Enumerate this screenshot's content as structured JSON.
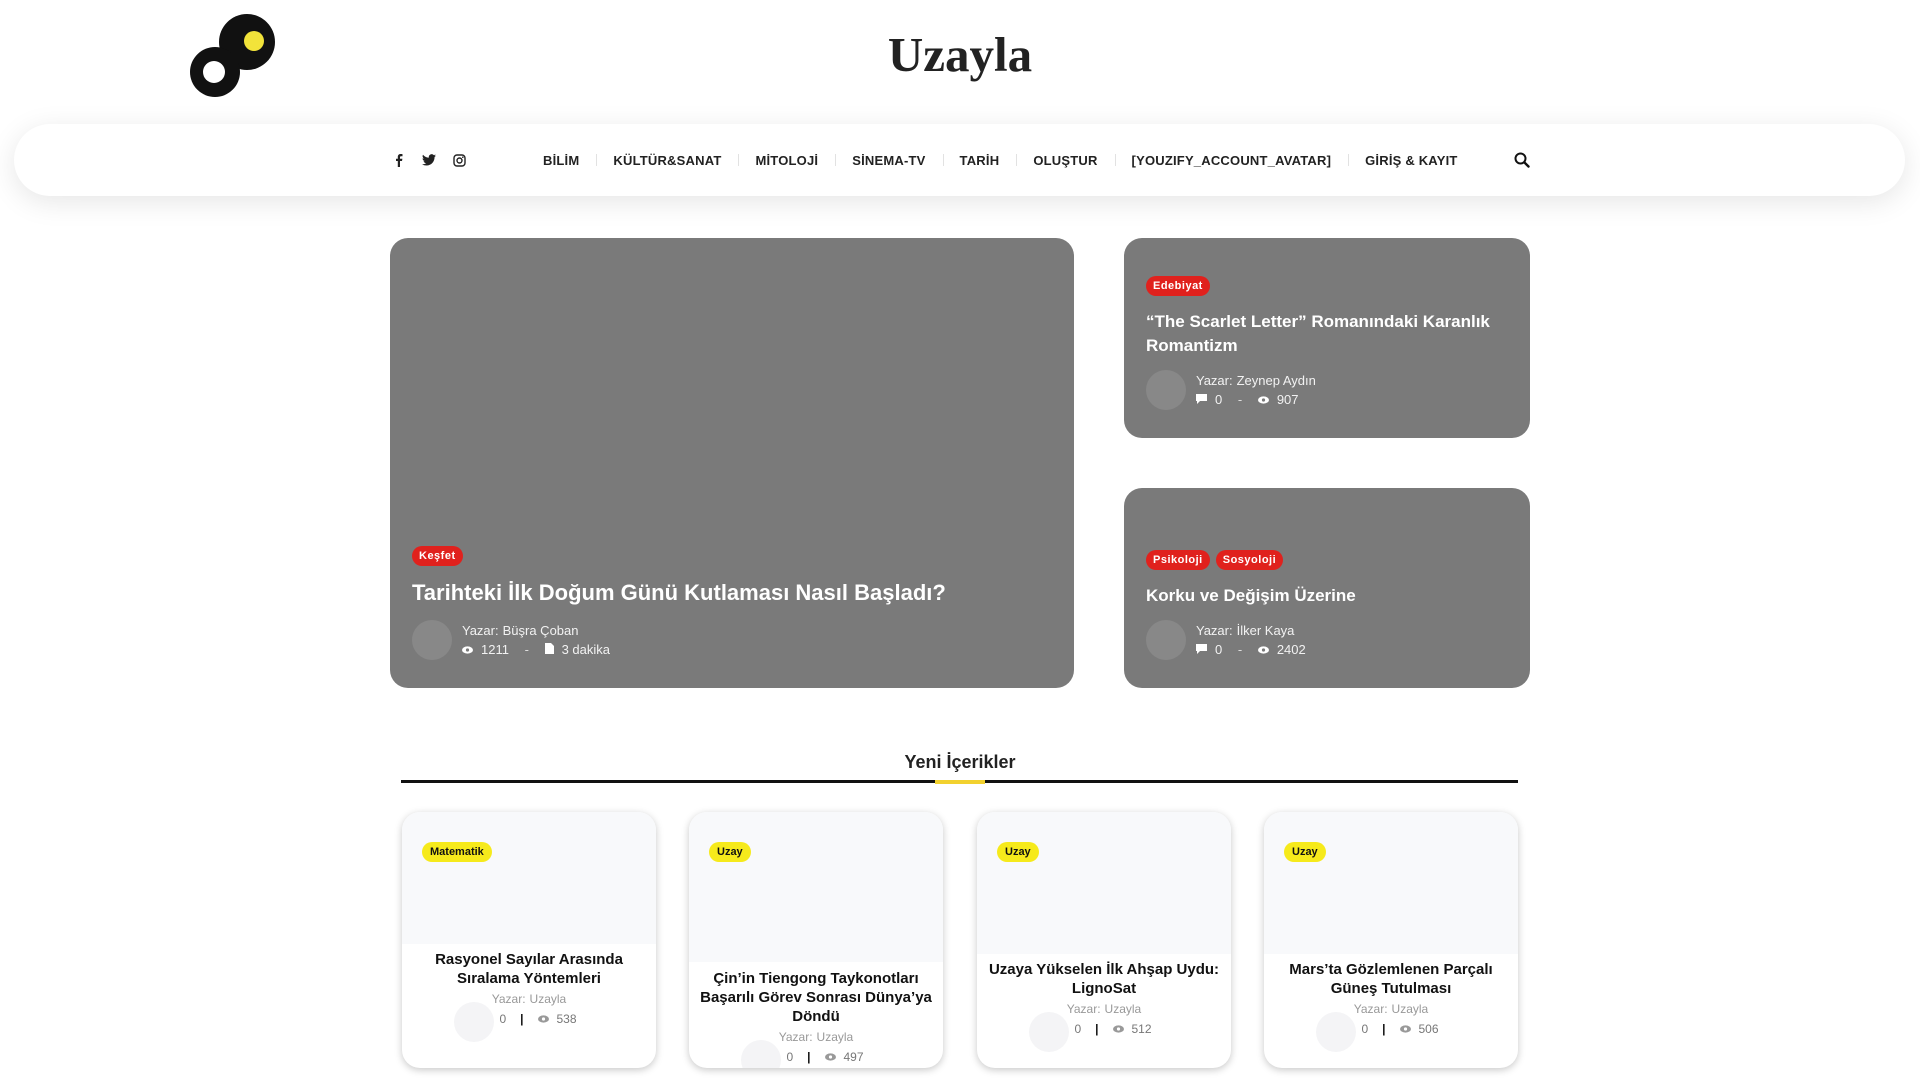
{
  "site": {
    "title": "Uzayla"
  },
  "nav": {
    "social": [
      "facebook-icon",
      "twitter-icon",
      "instagram-icon"
    ],
    "items": [
      "BİLİM",
      "KÜLTÜR&SANAT",
      "MİTOLOJİ",
      "SİNEMA-TV",
      "TARİH",
      "OLUŞTUR",
      "[YOUZIFY_ACCOUNT_AVATAR]",
      "GİRİŞ & KAYIT"
    ],
    "search_icon": "search-icon"
  },
  "featured": {
    "main": {
      "category": "Keşfet",
      "title": "Tarihteki İlk Doğum Günü Kutlaması Nasıl Başladı?",
      "author_label": "Yazar:",
      "author": "Büşra Çoban",
      "views": "1211",
      "read_time": "3 dakika"
    },
    "side": [
      {
        "categories": [
          "Edebiyat"
        ],
        "title": "“The Scarlet Letter” Romanındaki Karanlık Romantizm",
        "author_label": "Yazar:",
        "author": "Zeynep Aydın",
        "comments": "0",
        "views": "907"
      },
      {
        "categories": [
          "Psikoloji",
          "Sosyoloji"
        ],
        "title": "Korku ve Değişim Üzerine",
        "author_label": "Yazar:",
        "author": "İlker Kaya",
        "comments": "0",
        "views": "2402"
      }
    ]
  },
  "section": {
    "title": "Yeni İçerikler",
    "accent_color": "#f2d12e"
  },
  "posts": [
    {
      "category": "Matematik",
      "title": "Rasyonel Sayılar Arasında Sıralama Yöntemleri",
      "author_label": "Yazar:",
      "author": "Uzayla",
      "comments": "0",
      "views": "538"
    },
    {
      "category": "Uzay",
      "title": "Çin’in Tiengong Taykonotları Başarılı Görev Sonrası Dünya’ya Döndü",
      "author_label": "Yazar:",
      "author": "Uzayla",
      "comments": "0",
      "views": "497"
    },
    {
      "category": "Uzay",
      "title": "Uzaya Yükselen İlk Ahşap Uydu: LignoSat",
      "author_label": "Yazar:",
      "author": "Uzayla",
      "comments": "0",
      "views": "512"
    },
    {
      "category": "Uzay",
      "title": "Mars’ta Gözlemlenen Parçalı Güneş Tutulması",
      "author_label": "Yazar:",
      "author": "Uzayla",
      "comments": "0",
      "views": "506"
    }
  ],
  "colors": {
    "badge_red": "#e0211d",
    "badge_yellow": "#f6ea1b",
    "card_overlay": "#7a7a7a"
  }
}
